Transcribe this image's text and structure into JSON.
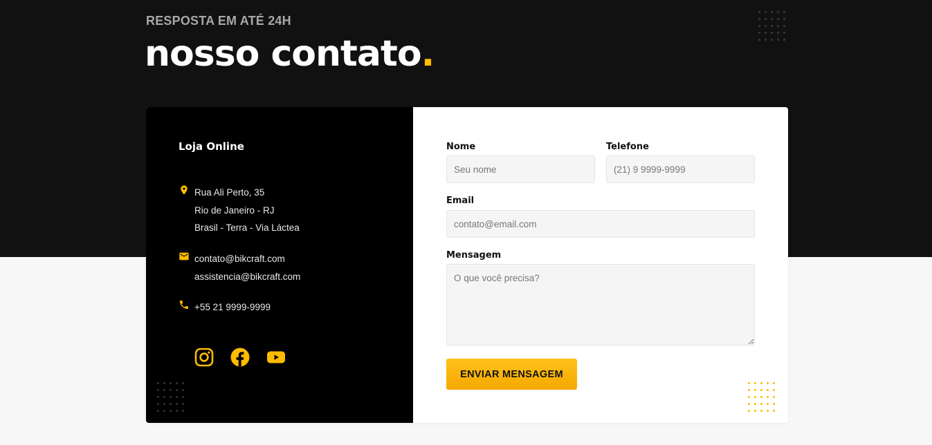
{
  "header": {
    "subtitle": "RESPOSTA EM ATÉ 24H",
    "title": "nosso contato",
    "title_dot": "."
  },
  "info": {
    "store_title": "Loja Online",
    "address": [
      "Rua Ali Perto, 35",
      "Rio de Janeiro - RJ",
      "Brasil - Terra - Via Láctea"
    ],
    "emails": [
      "contato@bikcraft.com",
      "assistencia@bikcraft.com"
    ],
    "phone": "+55 21 9999-9999",
    "socials": [
      "instagram-icon",
      "facebook-icon",
      "youtube-icon"
    ]
  },
  "form": {
    "name_label": "Nome",
    "name_placeholder": "Seu nome",
    "phone_label": "Telefone",
    "phone_placeholder": "(21) 9 9999-9999",
    "email_label": "Email",
    "email_placeholder": "contato@email.com",
    "message_label": "Mensagem",
    "message_placeholder": "O que você precisa?",
    "submit_label": "ENVIAR MENSAGEM"
  },
  "colors": {
    "accent": "#ffbb00",
    "dark_band": "#111111",
    "info_panel": "#000000",
    "page_bg": "#f7f7f7"
  }
}
